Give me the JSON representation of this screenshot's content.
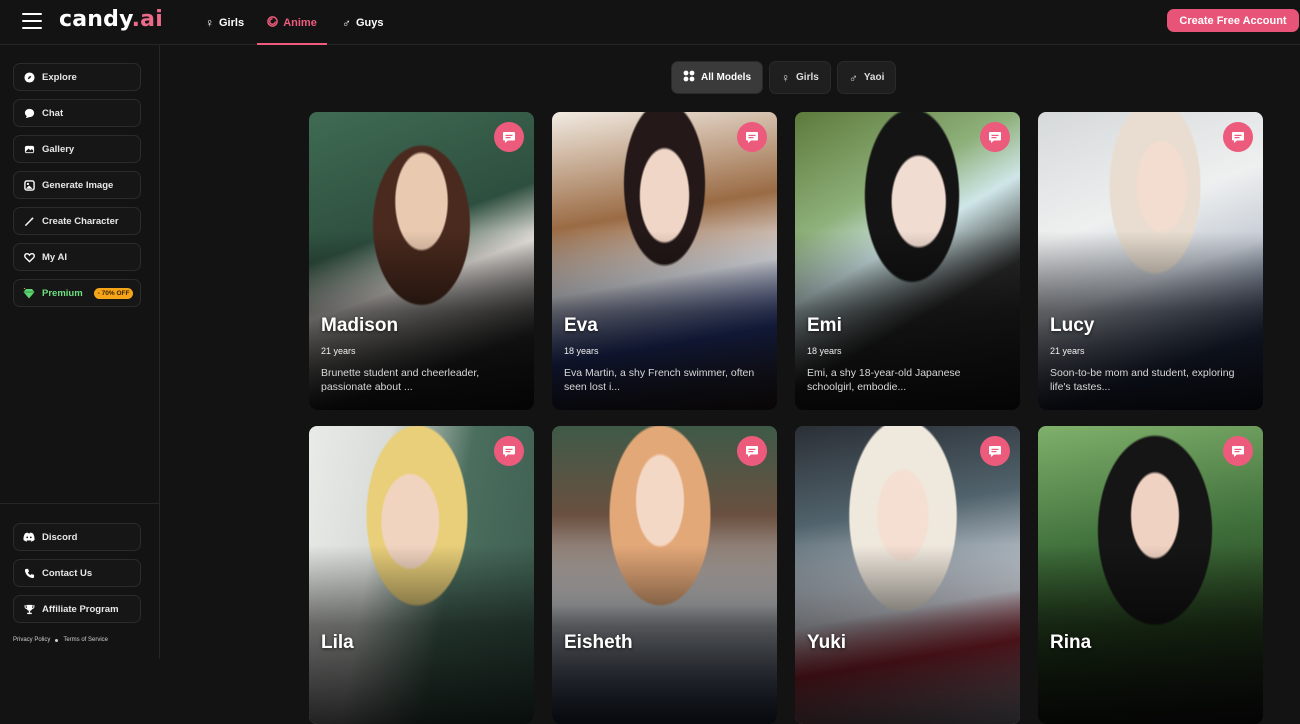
{
  "brand": {
    "name": "candy",
    "suffix": ".ai"
  },
  "nav": {
    "categories": [
      {
        "label": "Girls",
        "icon": "female-icon"
      },
      {
        "label": "Anime",
        "icon": "anime-icon"
      },
      {
        "label": "Guys",
        "icon": "male-icon"
      }
    ],
    "active": "Anime",
    "cta_label": "Create Free Account"
  },
  "sidebar": {
    "items": [
      {
        "label": "Explore",
        "icon": "compass-icon"
      },
      {
        "label": "Chat",
        "icon": "chat-icon"
      },
      {
        "label": "Gallery",
        "icon": "gallery-icon"
      },
      {
        "label": "Generate Image",
        "icon": "image-icon"
      },
      {
        "label": "Create Character",
        "icon": "wand-icon"
      },
      {
        "label": "My AI",
        "icon": "heart-icon"
      },
      {
        "label": "Premium",
        "icon": "diamond-icon",
        "badge": "- 70% OFF"
      }
    ],
    "bottom_items": [
      {
        "label": "Discord",
        "icon": "discord-icon"
      },
      {
        "label": "Contact Us",
        "icon": "phone-icon"
      },
      {
        "label": "Affiliate Program",
        "icon": "trophy-icon"
      }
    ],
    "legal": {
      "privacy": "Privacy Policy",
      "terms": "Terms of Service"
    }
  },
  "filters": [
    {
      "label": "All Models",
      "icon": "grid-icon",
      "active": true
    },
    {
      "label": "Girls",
      "icon": "female-icon",
      "active": false
    },
    {
      "label": "Yaoi",
      "icon": "male-icon",
      "active": false
    }
  ],
  "cards": [
    {
      "name": "Madison",
      "age": "21 years",
      "desc": "Brunette student and cheerleader, passionate about ..."
    },
    {
      "name": "Eva",
      "age": "18 years",
      "desc": "Eva Martin, a shy French swimmer, often seen lost i..."
    },
    {
      "name": "Emi",
      "age": "18 years",
      "desc": "Emi, a shy 18-year-old Japanese schoolgirl, embodie..."
    },
    {
      "name": "Lucy",
      "age": "21 years",
      "desc": "Soon-to-be mom and student, exploring life's tastes..."
    },
    {
      "name": "Lila",
      "age": "",
      "desc": ""
    },
    {
      "name": "Eisheth",
      "age": "",
      "desc": ""
    },
    {
      "name": "Yuki",
      "age": "",
      "desc": ""
    },
    {
      "name": "Rina",
      "age": "",
      "desc": ""
    }
  ],
  "colors": {
    "accent": "#e85477",
    "premium": "#6ee080",
    "badge": "#f6a418"
  }
}
